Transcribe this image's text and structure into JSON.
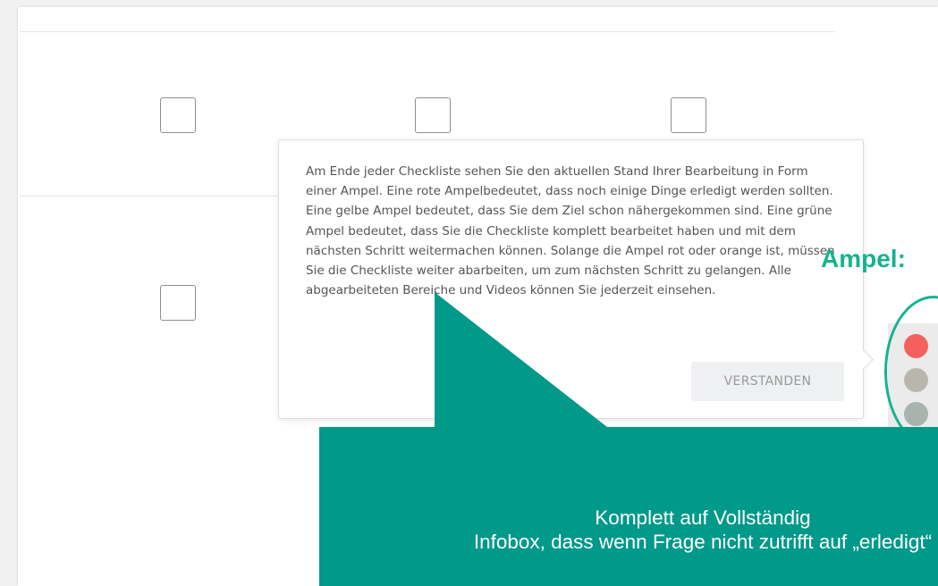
{
  "tooltip": {
    "text": "Am Ende jeder Checkliste sehen Sie den aktuellen Stand Ihrer Bearbeitung in Form einer Ampel. Eine rote Ampelbedeutet, dass noch einige Dinge erledigt werden sollten. Eine gelbe Ampel bedeutet, dass Sie dem Ziel schon nähergekommen sind. Eine grüne Ampel bedeutet, dass Sie die Checkliste komplett bearbeitet haben und mit dem nächsten Schritt weitermachen können. Solange die Ampel rot oder orange ist, müssen Sie die Checkliste weiter abarbeiten, um zum nächsten Schritt zu gelangen. Alle abgearbeiteten Bereiche und Videos können Sie jederzeit einsehen.",
    "button_label": "VERSTANDEN"
  },
  "annotation": {
    "ampel_label": "Ampel:",
    "callout_lines": [
      "Komplett auf Vollständig",
      "Infobox, dass wenn Frage nicht zutrifft auf „erledigt“"
    ]
  },
  "colors": {
    "accent_teal": "#16b38f",
    "callout_fill": "#00998a",
    "ampel_red": "#f4615c",
    "ampel_yellow": "#b9b7ad",
    "ampel_green": "#a9b3ae"
  }
}
